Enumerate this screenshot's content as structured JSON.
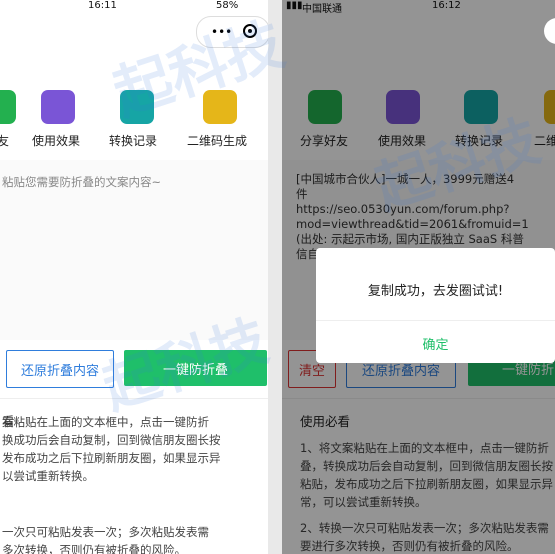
{
  "left_phone": {
    "status_time": "16:11",
    "status_battery": "58%",
    "icons": [
      {
        "label": "友",
        "icon": "share-friends-icon",
        "color": "#23b04f"
      },
      {
        "label": "使用效果",
        "icon": "aperture-icon",
        "color": "#7a55d6"
      },
      {
        "label": "转换记录",
        "icon": "clock-icon",
        "color": "#16a5a5"
      },
      {
        "label": "二维码生成",
        "icon": "qr-code-icon",
        "color": "#e5b619"
      }
    ],
    "placeholder": "粘贴您需要防折叠的文案内容~",
    "restore_button": "还原折叠内容",
    "fold_button": "一键防折叠",
    "guide_title": "看",
    "guide_p1": "案粘贴在上面的文本框中，点击一键防折\n换成功后会自动复制，回到微信朋友圈长按\n发布成功之后下拉刷新朋友圈，如果显示异\n以尝试重新转换。",
    "guide_p2": "一次只可粘贴发表一次；多次粘贴发表需\n多次转换，否则仍有被折叠的风险。"
  },
  "right_phone": {
    "status_carrier": "中国联通",
    "status_time": "16:12",
    "icons": [
      {
        "label": "分享好友",
        "icon": "wechat-icon",
        "color": "#23b04f"
      },
      {
        "label": "使用效果",
        "icon": "aperture-icon",
        "color": "#7a55d6"
      },
      {
        "label": "转换记录",
        "icon": "clock-icon",
        "color": "#16a5a5"
      },
      {
        "label": "二维",
        "icon": "qr-code-icon",
        "color": "#e5b619"
      }
    ],
    "textarea_value": "[中国城市合伙人]一城一人，3999元赠送4\n件\nhttps://seo.0530yun.com/forum.php?\nmod=viewthread&tid=2061&fromuid=1\n(出处: 示起示市场, 国内正版独立 SaaS 科普\n信自",
    "clear_button": "清空",
    "restore_button": "还原折叠内容",
    "fold_button": "一键防折",
    "guide_title": "使用必看",
    "guide_p1": "1、将文案粘贴在上面的文本框中，点击一键防折\n叠，转换成功后会自动复制，回到微信朋友圈长按\n粘贴，发布成功之后下拉刷新朋友圈，如果显示异\n常，可以尝试重新转换。",
    "guide_p2": "2、转换一次只可粘贴发表一次；多次粘贴发表需\n要进行多次转换，否则仍有被折叠的风险。",
    "dialog_message": "复制成功，去发圈试试!",
    "dialog_confirm": "确定"
  }
}
